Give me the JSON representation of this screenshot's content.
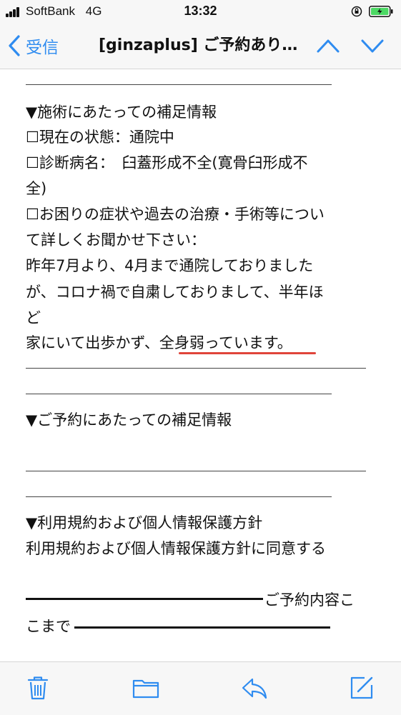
{
  "status_bar": {
    "carrier": "SoftBank",
    "network": "4G",
    "time": "13:32"
  },
  "nav": {
    "back_label": "受信",
    "title": "[ginzaplus] ご予約あり…"
  },
  "email": {
    "section1_heading": "▼施術にあたっての補足情報",
    "status_line": "☐現在の状態：通院中",
    "diagnosis_line1": "☐診断病名：　臼蓋形成不全(寛骨臼形成不",
    "diagnosis_line2": "全)",
    "symptoms_line1": "☐お困りの症状や過去の治療・手術等につい",
    "symptoms_line2": "て詳しくお聞かせ下さい：",
    "body_line1": "昨年7月より、4月まで通院しておりました",
    "body_line2": "が、コロナ禍で自粛しておりまして、半年ほ",
    "body_line3": "ど",
    "body_line4_prefix": "家にいて出歩かず、",
    "body_line4_highlight": "全身弱っています",
    "body_line4_suffix": "。",
    "section2_heading": "▼ご予約にあたっての補足情報",
    "section3_heading": "▼利用規約および個人情報保護方針",
    "agree_line": "利用規約および個人情報保護方針に同意する",
    "footer_line1": "ご予約内容こ",
    "footer_line2": "こまで"
  },
  "toolbar": {
    "icons": [
      "trash-icon",
      "folder-icon",
      "reply-icon",
      "compose-icon"
    ]
  },
  "colors": {
    "accent": "#2f8cf0",
    "highlight_underline": "#e0443a",
    "battery_fill": "#4cd964"
  }
}
